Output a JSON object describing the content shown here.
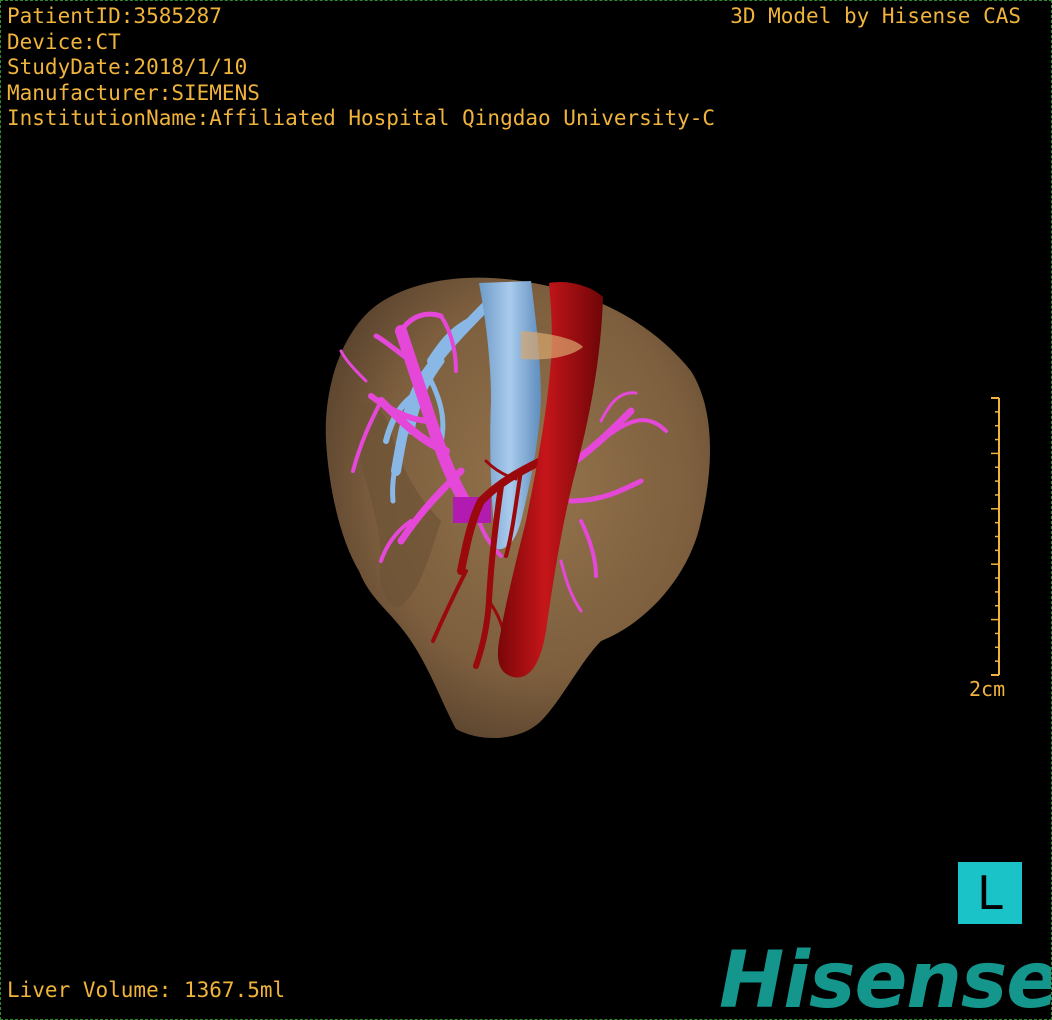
{
  "overlay": {
    "patient_id": "PatientID:3585287",
    "device": "Device:CT",
    "study_date": "StudyDate:2018/1/10",
    "manufacturer": "Manufacturer:SIEMENS",
    "institution": "InstitutionName:Affiliated Hospital Qingdao University-C",
    "credit": "3D Model by Hisense CAS",
    "liver_volume": "Liver Volume: 1367.5ml",
    "scale_label": "2cm",
    "orientation_marker": "L",
    "brand": "Hisense"
  },
  "colors": {
    "overlay_text": "#f0b43c",
    "liver": "#8a6a43",
    "artery": "#b30c10",
    "portal_vein": "#e243d6",
    "hepatic_vein": "#7fb1e0",
    "orientation_bg": "#19c3c8",
    "brand": "#14968c",
    "viewport_border": "#2e8b2e"
  },
  "model": {
    "structures": [
      "liver",
      "aorta-artery",
      "portal-vein",
      "hepatic-vein"
    ]
  }
}
